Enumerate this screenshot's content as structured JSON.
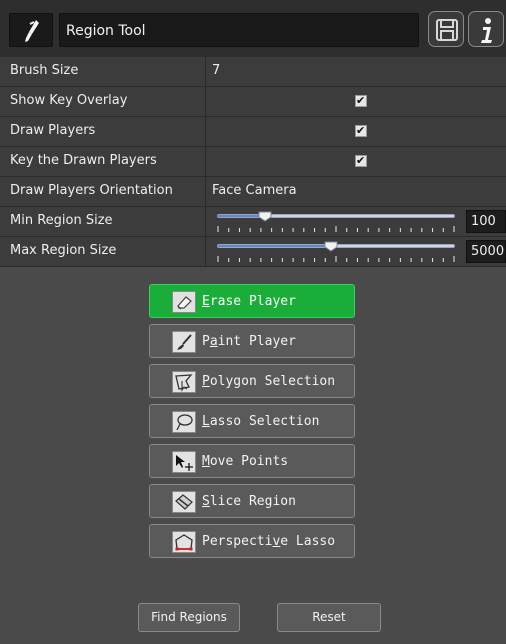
{
  "header": {
    "tool_icon": "brush-pen-icon",
    "title": "Region Tool",
    "save_icon": "save-icon",
    "info_icon": "info-icon"
  },
  "properties": {
    "brush_size": {
      "label": "Brush Size",
      "value": "7"
    },
    "show_key_overlay": {
      "label": "Show Key Overlay",
      "checked": true
    },
    "draw_players": {
      "label": "Draw Players",
      "checked": true
    },
    "key_drawn_players": {
      "label": "Key the Drawn Players",
      "checked": true
    },
    "orientation": {
      "label": "Draw Players Orientation",
      "value": "Face Camera"
    },
    "min_region": {
      "label": "Min Region Size",
      "value": "100",
      "slider_fraction": 0.2
    },
    "max_region": {
      "label": "Max Region Size",
      "value": "5000",
      "slider_fraction": 0.48
    }
  },
  "actions": [
    {
      "label": "Erase Player",
      "mnemonic": "E",
      "icon": "eraser-icon",
      "active": true
    },
    {
      "label": "Paint Player",
      "mnemonic": "a",
      "icon": "paintbrush-icon",
      "active": false
    },
    {
      "label": "Polygon Selection",
      "mnemonic": "P",
      "icon": "polygon-select-icon",
      "active": false
    },
    {
      "label": "Lasso Selection",
      "mnemonic": "L",
      "icon": "lasso-icon",
      "active": false
    },
    {
      "label": "Move Points",
      "mnemonic": "M",
      "icon": "move-points-icon",
      "active": false
    },
    {
      "label": "Slice Region",
      "mnemonic": "S",
      "icon": "slice-icon",
      "active": false
    },
    {
      "label": "Perspective Lasso",
      "mnemonic": "v",
      "icon": "perspective-lasso-icon",
      "active": false
    }
  ],
  "footer": {
    "find_label": "Find Regions",
    "reset_label": "Reset"
  },
  "colors": {
    "active_button": "#1aad3a",
    "panel_bg": "#4a4a4a"
  }
}
